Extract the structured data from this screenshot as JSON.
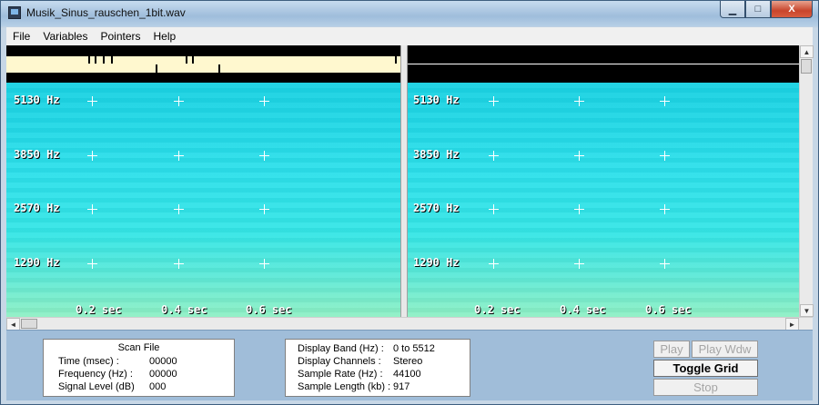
{
  "window": {
    "title": "Musik_Sinus_rauschen_1bit.wav",
    "min_glyph": "▁",
    "max_glyph": "□",
    "close_glyph": "X"
  },
  "menu": [
    "File",
    "Variables",
    "Pointers",
    "Help"
  ],
  "panes": {
    "freq_labels": [
      "5130 Hz",
      "3850 Hz",
      "2570 Hz",
      "1290 Hz"
    ],
    "time_labels": [
      "0.2 sec",
      "0.4 sec",
      "0.6 sec"
    ]
  },
  "scrollbar": {
    "up": "▲",
    "down": "▼",
    "left": "◄",
    "right": "►"
  },
  "scan_file": {
    "title": "Scan File",
    "rows": [
      {
        "label": "Time (msec) :",
        "value": "00000"
      },
      {
        "label": "Frequency (Hz) :",
        "value": "00000"
      },
      {
        "label": "Signal Level (dB)",
        "value": "000"
      }
    ]
  },
  "display_info": {
    "rows": [
      {
        "label": "Display Band (Hz) :",
        "value": "0 to 5512"
      },
      {
        "label": "Display Channels :",
        "value": "Stereo"
      },
      {
        "label": "Sample Rate (Hz) :",
        "value": "44100"
      },
      {
        "label": "Sample Length (kb) :",
        "value": "917"
      }
    ]
  },
  "buttons": {
    "play": "Play",
    "play_wdw": "Play Wdw",
    "toggle_grid": "Toggle Grid",
    "stop": "Stop"
  },
  "colors": {
    "spectrogram": "#2ce0ea",
    "strip": "#fff8cf",
    "panel": "#a0bdd9"
  }
}
